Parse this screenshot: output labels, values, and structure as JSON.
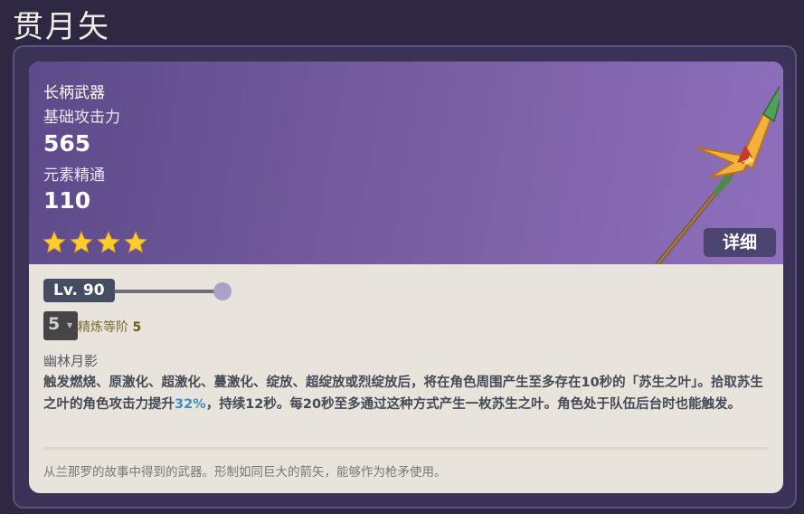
{
  "page": {
    "title": "贯月矢"
  },
  "weapon": {
    "type": "长柄武器",
    "base_atk_label": "基础攻击力",
    "base_atk_value": "565",
    "substat_label": "元素精通",
    "substat_value": "110",
    "rarity_stars": 4,
    "detail_button": "详细"
  },
  "level": {
    "badge": "Lv. 90",
    "slider_fraction": 1.0
  },
  "refinement": {
    "selected": "5",
    "label": "精炼等阶",
    "value": "5"
  },
  "passive": {
    "name": "幽林月影",
    "desc_part1": "触发燃烧、原激化、超激化、蔓激化、绽放、超绽放或烈绽放后，将在角色周围产生至多存在10秒的「苏生之叶」。拾取苏生之叶的角色攻击力提升",
    "desc_highlight": "32%",
    "desc_part2": "，持续12秒。每20秒至多通过这种方式产生一枚苏生之叶。角色处于队伍后台时也能触发。"
  },
  "lore": "从兰那罗的故事中得到的武器。形制如同巨大的箭矢，能够作为枪矛使用。",
  "colors": {
    "star": "#ffcc32",
    "highlight": "#3c8dc4",
    "card_top": "#7a5fa2",
    "card_bottom": "#e8e4dc"
  }
}
